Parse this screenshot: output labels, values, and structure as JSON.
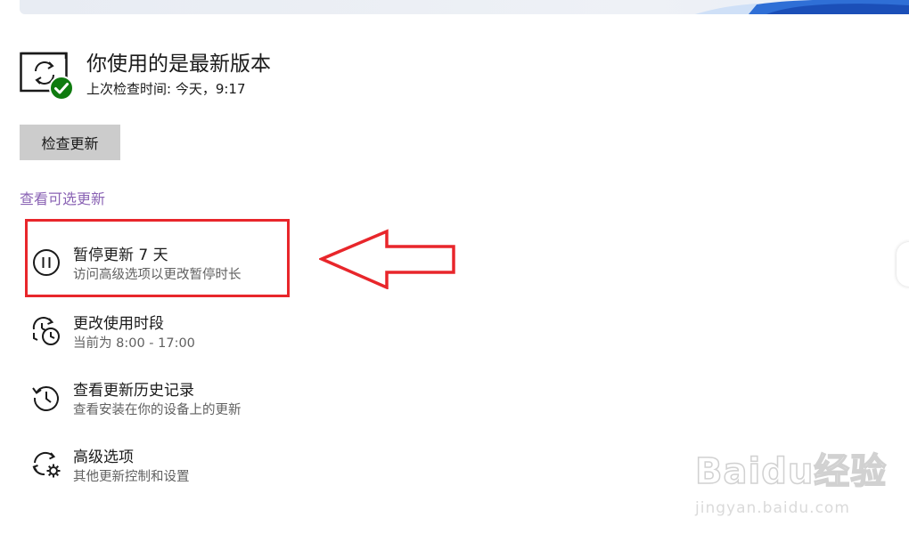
{
  "status": {
    "title": "你使用的是最新版本",
    "last_check": "上次检查时间: 今天，9:17",
    "icon": "sync-check-icon"
  },
  "actions": {
    "check_updates_label": "检查更新",
    "optional_updates_label": "查看可选更新"
  },
  "options": [
    {
      "title": "暂停更新 7 天",
      "desc": "访问高级选项以更改暂停时长",
      "icon": "pause-icon"
    },
    {
      "title": "更改使用时段",
      "desc": "当前为 8:00 - 17:00",
      "icon": "active-hours-icon"
    },
    {
      "title": "查看更新历史记录",
      "desc": "查看安装在你的设备上的更新",
      "icon": "history-icon"
    },
    {
      "title": "高级选项",
      "desc": "其他更新控制和设置",
      "icon": "advanced-gear-icon"
    }
  ],
  "annotation": {
    "highlight_color": "#e8262b",
    "arrow": "red-left-arrow"
  },
  "watermark": {
    "brand": "Baidu经验",
    "url": "jingyan.baidu.com"
  },
  "colors": {
    "link": "#8a63b4",
    "check_badge": "#0f7b0f",
    "button_bg": "#cccccc"
  }
}
